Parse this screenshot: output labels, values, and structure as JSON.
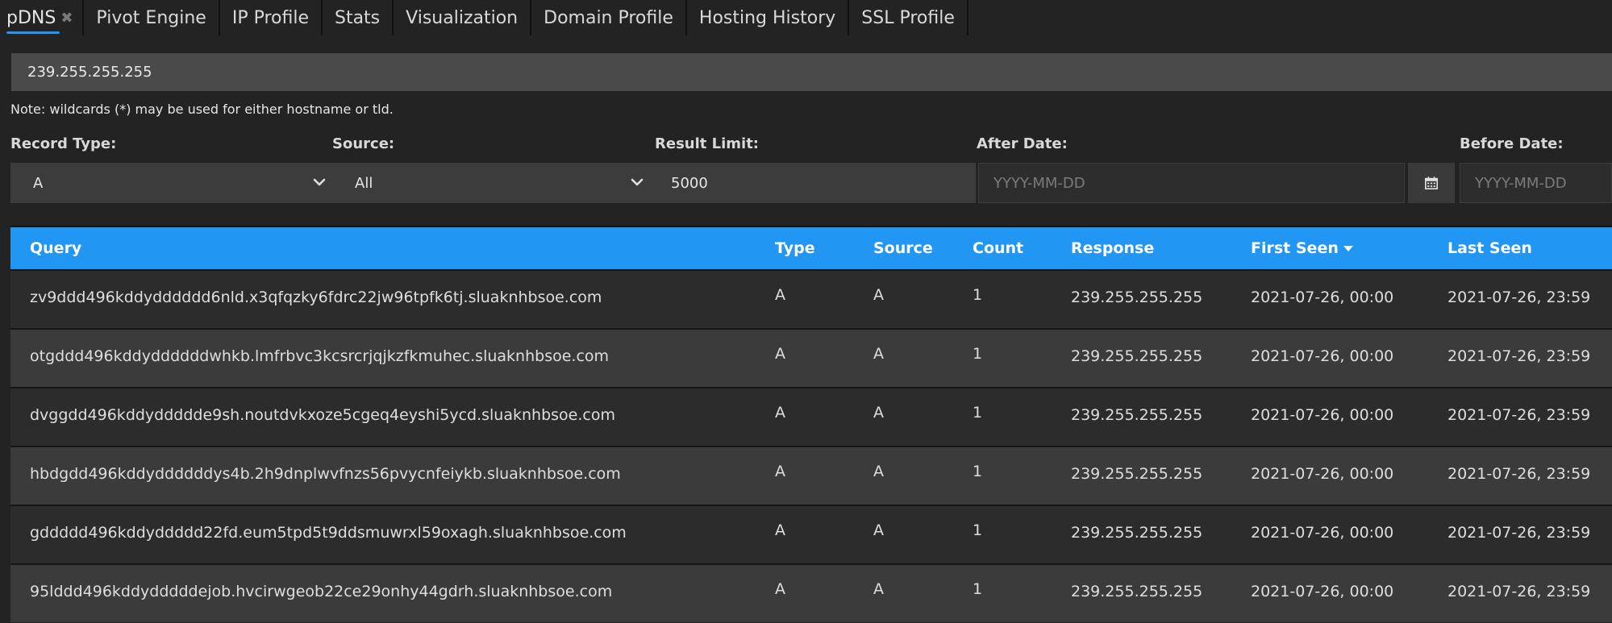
{
  "tabs": [
    {
      "label": "pDNS",
      "active": true,
      "closable": true
    },
    {
      "label": "Pivot Engine"
    },
    {
      "label": "IP Profile"
    },
    {
      "label": "Stats"
    },
    {
      "label": "Visualization"
    },
    {
      "label": "Domain Profile"
    },
    {
      "label": "Hosting History"
    },
    {
      "label": "SSL Profile"
    }
  ],
  "search": {
    "value": "239.255.255.255"
  },
  "note": "Note: wildcards (*) may be used for either hostname or tld.",
  "filters": {
    "record_type": {
      "label": "Record Type:",
      "value": "A"
    },
    "source": {
      "label": "Source:",
      "value": "All"
    },
    "result_limit": {
      "label": "Result Limit:",
      "value": "5000"
    },
    "after_date": {
      "label": "After Date:",
      "placeholder": "YYYY-MM-DD"
    },
    "before_date": {
      "label": "Before Date:",
      "placeholder": "YYYY-MM-DD"
    }
  },
  "table": {
    "headers": {
      "query": "Query",
      "type": "Type",
      "source": "Source",
      "count": "Count",
      "response": "Response",
      "first_seen": "First Seen",
      "last_seen": "Last Seen"
    },
    "sorted_by": "first_seen",
    "rows": [
      {
        "query": "zv9ddd496kddydddddd6nld.x3qfqzky6fdrc22jw96tpfk6tj.sluaknhbsoe.com",
        "type": "A",
        "source": "A",
        "count": "1",
        "response": "239.255.255.255",
        "first_seen": "2021-07-26, 00:00",
        "last_seen": "2021-07-26, 23:59"
      },
      {
        "query": "otgddd496kddyddddddwhkb.lmfrbvc3kcsrcrjqjkzfkmuhec.sluaknhbsoe.com",
        "type": "A",
        "source": "A",
        "count": "1",
        "response": "239.255.255.255",
        "first_seen": "2021-07-26, 00:00",
        "last_seen": "2021-07-26, 23:59"
      },
      {
        "query": "dvggdd496kddyddddde9sh.noutdvkxoze5cgeq4eyshi5ycd.sluaknhbsoe.com",
        "type": "A",
        "source": "A",
        "count": "1",
        "response": "239.255.255.255",
        "first_seen": "2021-07-26, 00:00",
        "last_seen": "2021-07-26, 23:59"
      },
      {
        "query": "hbdgdd496kddyddddddys4b.2h9dnplwvfnzs56pvycnfeiykb.sluaknhbsoe.com",
        "type": "A",
        "source": "A",
        "count": "1",
        "response": "239.255.255.255",
        "first_seen": "2021-07-26, 00:00",
        "last_seen": "2021-07-26, 23:59"
      },
      {
        "query": "gddddd496kddyddddd22fd.eum5tpd5t9ddsmuwrxl59oxagh.sluaknhbsoe.com",
        "type": "A",
        "source": "A",
        "count": "1",
        "response": "239.255.255.255",
        "first_seen": "2021-07-26, 00:00",
        "last_seen": "2021-07-26, 23:59"
      },
      {
        "query": "95lddd496kddydddddejob.hvcirwgeob22ce29onhy44gdrh.sluaknhbsoe.com",
        "type": "A",
        "source": "A",
        "count": "1",
        "response": "239.255.255.255",
        "first_seen": "2021-07-26, 00:00",
        "last_seen": "2021-07-26, 23:59"
      }
    ]
  },
  "colors": {
    "accent": "#2196f3",
    "background": "#232323",
    "row_dark": "#2c2c2c",
    "row_light": "#3b3b3b"
  },
  "icons": {
    "tab_close": "close-icon",
    "select_chevron": "chevron-down-icon",
    "calendar": "calendar-icon",
    "sort": "sort-desc-icon"
  }
}
